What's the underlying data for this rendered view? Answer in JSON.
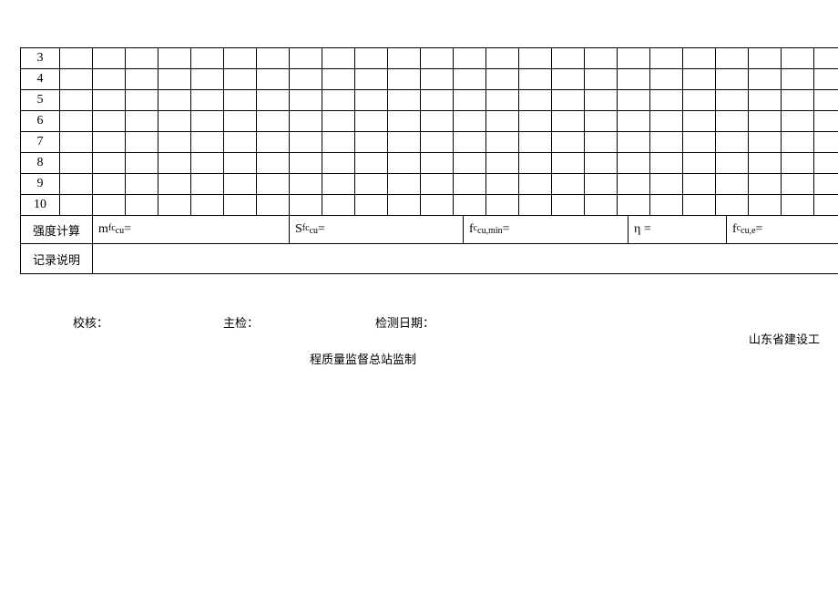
{
  "rows": [
    "3",
    "4",
    "5",
    "6",
    "7",
    "8",
    "9",
    "10"
  ],
  "calc": {
    "label": "强度计算",
    "formulas": {
      "m": "m",
      "m_sub": "fc",
      "m_subsub": "cu",
      "m_eq": " =",
      "s": "S",
      "s_sub": "fc",
      "s_subsub": "cu",
      "s_eq": "=",
      "fmin": "f",
      "fmin_sub": "c",
      "fmin_subsub": "cu,min",
      "fmin_eq": "=",
      "eta": "η =",
      "fe": "f",
      "fe_sub": "c",
      "fe_subsub": "cu,e",
      "fe_eq": "="
    }
  },
  "note": {
    "label": "记录说明"
  },
  "footer": {
    "check": "校核：",
    "main": "主检：",
    "date": "检测日期："
  },
  "org": {
    "right": "山东省建设工",
    "left": "程质量监督总站监制"
  }
}
